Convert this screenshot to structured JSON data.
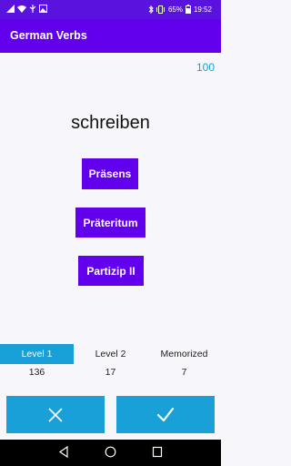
{
  "status_bar": {
    "battery": "65%",
    "time": "19:52",
    "icons": [
      "signal-icon",
      "wifi-icon",
      "usb-icon",
      "gallery-icon",
      "bluetooth-icon",
      "vibrate-icon",
      "battery-icon"
    ]
  },
  "app_bar": {
    "title": "German Verbs"
  },
  "score": "100",
  "verb": "schreiben",
  "tense_buttons": {
    "present": "Präsens",
    "preterite": "Präteritum",
    "participle": "Partizip II"
  },
  "tabs": [
    {
      "label": "Level 1",
      "count": "136",
      "active": true
    },
    {
      "label": "Level 2",
      "count": "17",
      "active": false
    },
    {
      "label": "Memorized",
      "count": "7",
      "active": false
    }
  ],
  "actions": {
    "wrong_icon": "close-icon",
    "right_icon": "check-icon"
  },
  "nav_bar": {
    "icons": [
      "back-icon",
      "home-icon",
      "recents-icon"
    ]
  },
  "colors": {
    "primary": "#6200ee",
    "status_bar": "#5a12de",
    "accent": "#1aa0d8",
    "background": "#f7f7fb"
  }
}
